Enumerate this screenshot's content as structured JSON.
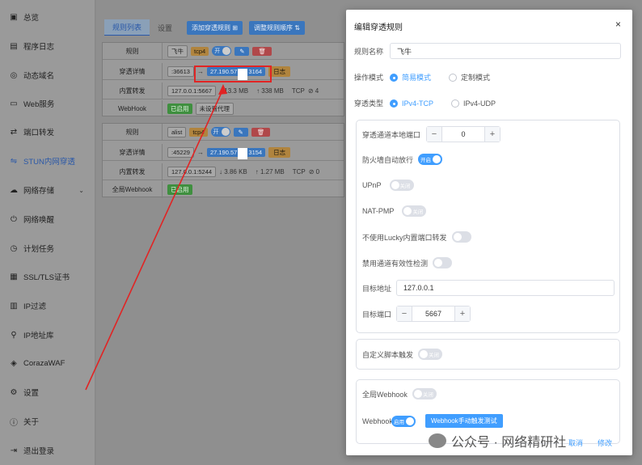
{
  "sidebar": {
    "items": [
      {
        "label": "总览",
        "icon": "home-icon"
      },
      {
        "label": "程序日志",
        "icon": "log-icon"
      },
      {
        "label": "动态域名",
        "icon": "ddns-icon"
      },
      {
        "label": "Web服务",
        "icon": "web-icon"
      },
      {
        "label": "端口转发",
        "icon": "port-forward-icon"
      },
      {
        "label": "STUN内网穿透",
        "icon": "stun-icon",
        "active": true
      },
      {
        "label": "网络存储",
        "icon": "storage-icon",
        "expandable": true
      },
      {
        "label": "网络唤醒",
        "icon": "wol-icon"
      },
      {
        "label": "计划任务",
        "icon": "schedule-icon"
      },
      {
        "label": "SSL/TLS证书",
        "icon": "certificate-icon"
      },
      {
        "label": "IP过滤",
        "icon": "ip-filter-icon"
      },
      {
        "label": "IP地址库",
        "icon": "ip-db-icon"
      },
      {
        "label": "CorazaWAF",
        "icon": "waf-icon"
      },
      {
        "label": "设置",
        "icon": "gear-icon"
      },
      {
        "label": "关于",
        "icon": "about-icon"
      },
      {
        "label": "退出登录",
        "icon": "logout-icon"
      }
    ]
  },
  "main": {
    "tabs": [
      "规则列表",
      "设置"
    ],
    "add_rule_button": "添加穿透规则",
    "reorder_button": "调整规则顺序",
    "rules": [
      {
        "name": "飞牛",
        "protocol": "tcp4",
        "toggle": "开",
        "row_labels": [
          "规则",
          "穿透详情",
          "内置转发",
          "WebHook"
        ],
        "local_port": ":36613",
        "arrow": "→",
        "public_addr_start": "27.190.57.",
        "public_addr_end": "3164",
        "log_button": "日志",
        "forward_target": "127.0.0.1:5667",
        "download": "↓ 13.3 MB",
        "upload": "↑ 338 MB",
        "transport": "TCP",
        "conns": "⊘ 4",
        "webhook_status": "已启用",
        "webhook_proxy": "未设置代理"
      },
      {
        "name": "alist",
        "protocol": "tcp4",
        "toggle": "开",
        "row_labels": [
          "规则",
          "穿透详情",
          "内置转发",
          "全局Webhook"
        ],
        "local_port": ":45229",
        "arrow": "→",
        "public_addr_start": "27.190.57.",
        "public_addr_end": "3154",
        "log_button": "日志",
        "forward_target": "127.0.0.1:5244",
        "download": "↓ 3.86 KB",
        "upload": "↑ 1.27 MB",
        "transport": "TCP",
        "conns": "⊘ 0",
        "webhook_status": "已启用"
      }
    ]
  },
  "dialog": {
    "title": "编辑穿透规则",
    "close": "×",
    "rule_name_label": "规则名称",
    "rule_name_value": "飞牛",
    "mode_label": "操作模式",
    "mode_options": [
      "简易模式",
      "定制模式"
    ],
    "type_label": "穿透类型",
    "type_options": [
      "IPv4-TCP",
      "IPv4-UDP"
    ],
    "local_port_label": "穿透通道本地端口",
    "local_port_value": "0",
    "firewall_label": "防火墙自动放行",
    "firewall_state": "开启",
    "upnp_label": "UPnP",
    "upnp_state": "关闭",
    "natpmp_label": "NAT-PMP",
    "natpmp_state": "关闭",
    "no_builtin_label": "不使用Lucky内置端口转发",
    "disable_check_label": "禁用通道有效性检测",
    "target_addr_label": "目标地址",
    "target_addr_value": "127.0.0.1",
    "target_port_label": "目标端口",
    "target_port_value": "5667",
    "custom_script_label": "自定义脚本触发",
    "custom_script_state": "关闭",
    "global_webhook_label": "全局Webhook",
    "global_webhook_state": "关闭",
    "webhook_label": "Webhook",
    "webhook_state": "启用",
    "webhook_test_button": "Webhook手动触发测试",
    "cancel": "取消",
    "confirm": "修改"
  },
  "watermark": "公众号 · 网络精研社",
  "colors": {
    "accent": "#409eff",
    "highlight_box": "#e12424",
    "arrow": "#e12424"
  }
}
